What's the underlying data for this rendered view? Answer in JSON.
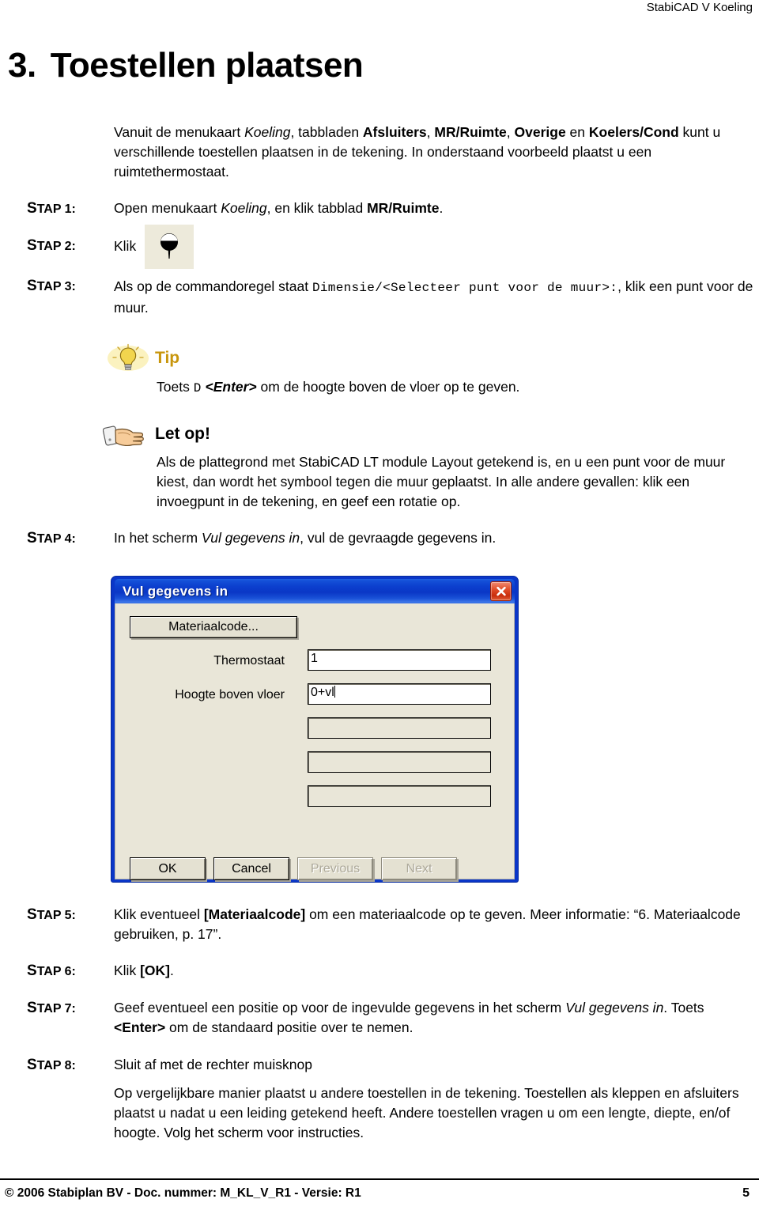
{
  "header": {
    "running_title": "StabiCAD V Koeling"
  },
  "title": {
    "number": "3.",
    "text": "Toestellen plaatsen"
  },
  "intro": {
    "line1_a": "Vanuit de menukaart ",
    "line1_koeling": "Koeling",
    "line1_b": ", tabbladen ",
    "tab1": "Afsluiters",
    "sep1": ", ",
    "tab2": "MR/Ruimte",
    "sep2": ", ",
    "tab3": "Overige",
    "sep3": " en ",
    "tab4": "Koelers/Cond",
    "line2": "kunt u verschillende toestellen plaatsen in de tekening. In onderstaand voorbeeld plaatst u een ruimtethermostaat."
  },
  "steps": [
    {
      "label_cap": "S",
      "label_rest": "TAP 1:",
      "body_a": "Open menukaart ",
      "body_italic": "Koeling",
      "body_b": ", en klik tabblad ",
      "body_bold": "MR/Ruimte",
      "body_c": "."
    },
    {
      "label_cap": "S",
      "label_rest": "TAP 2:",
      "body_a": "Klik",
      "icon": "thermostat-symbol-icon"
    },
    {
      "label_cap": "S",
      "label_rest": "TAP 3:",
      "body_a": "Als op de commandoregel staat ",
      "body_mono": "Dimensie/<Selecteer punt voor de muur>:",
      "body_b": ", klik een punt voor de muur."
    },
    {
      "label_cap": "S",
      "label_rest": "TAP 4:",
      "body_a": "In het scherm ",
      "body_italic": "Vul gegevens in",
      "body_b": ", vul de gevraagde gegevens in."
    },
    {
      "label_cap": "S",
      "label_rest": "TAP 5:",
      "body_a": "Klik eventueel ",
      "body_bold": "[Materiaalcode]",
      "body_b": " om een materiaalcode op te geven. Meer informatie: “6. Materiaalcode gebruiken,  p. 17”."
    },
    {
      "label_cap": "S",
      "label_rest": "TAP 6:",
      "body_a": "Klik ",
      "body_bold": "[OK]",
      "body_b": "."
    },
    {
      "label_cap": "S",
      "label_rest": "TAP 7:",
      "body_a": "Geef eventueel een positie op voor de ingevulde gegevens in het scherm ",
      "body_italic": "Vul gegevens in",
      "body_b": ". Toets ",
      "body_bold": "<Enter>",
      "body_c": " om de standaard positie over te nemen."
    },
    {
      "label_cap": "S",
      "label_rest": "TAP 8:",
      "body_a": "Sluit af met de rechter muisknop",
      "body_extra": "Op vergelijkbare manier plaatst u andere toestellen in de tekening. Toestellen als kleppen en afsluiters plaatst u nadat u een leiding getekend heeft. Andere toestellen vragen u om een lengte, diepte, en/of hoogte. Volg het scherm voor instructies."
    }
  ],
  "tip": {
    "icon": "lightbulb-icon",
    "heading": "Tip",
    "body_a": "Toets ",
    "body_mono": "D",
    "body_b": " ",
    "body_italic": "<Enter>",
    "body_c": " om de hoogte boven de vloer op te geven.",
    "heading_color": "#D4A017"
  },
  "note": {
    "icon": "pointing-hand-icon",
    "heading": "Let op!",
    "body": "Als de plattegrond met StabiCAD LT module Layout getekend is, en u een punt voor de muur kiest, dan wordt het symbool tegen die muur geplaatst. In alle andere gevallen: klik een invoegpunt in de tekening, en geef een rotatie op."
  },
  "dialog": {
    "title": "Vul gegevens in",
    "close_icon": "close-icon",
    "materiaalcode_button": "Materiaalcode...",
    "fields": [
      {
        "label": "Thermostaat",
        "value": "1",
        "state": "active"
      },
      {
        "label": "Hoogte boven vloer",
        "value": "0+vl",
        "state": "active"
      },
      {
        "label": "",
        "value": "",
        "state": "blank"
      },
      {
        "label": "",
        "value": "",
        "state": "blank"
      },
      {
        "label": "",
        "value": "",
        "state": "blank"
      }
    ],
    "buttons": [
      {
        "label": "OK",
        "enabled": true
      },
      {
        "label": "Cancel",
        "enabled": true
      },
      {
        "label": "Previous",
        "enabled": false
      },
      {
        "label": "Next",
        "enabled": false
      }
    ],
    "titlebar_color": "#0A37C6",
    "client_color": "#E9E6D8"
  },
  "footer": {
    "left": "© 2006 Stabiplan BV - Doc. nummer: M_KL_V_R1 - Versie: R1",
    "page_number": "5"
  }
}
